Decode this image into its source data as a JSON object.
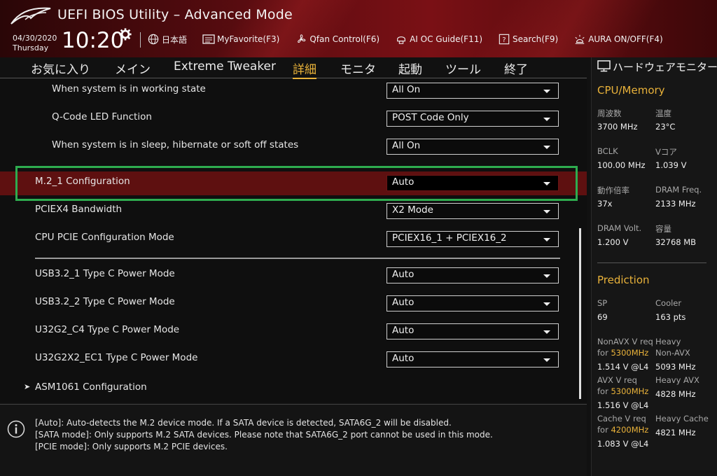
{
  "header": {
    "title": "UEFI BIOS Utility – Advanced Mode",
    "date": "04/30/2020",
    "day": "Thursday",
    "time": "10:20",
    "tools": [
      {
        "name": "language",
        "label": "日本語",
        "icon": "globe-icon"
      },
      {
        "name": "myfavorite",
        "label": "MyFavorite(F3)",
        "icon": "favorite-list-icon"
      },
      {
        "name": "qfan",
        "label": "Qfan Control(F6)",
        "icon": "fan-icon"
      },
      {
        "name": "aioc",
        "label": "AI OC Guide(F11)",
        "icon": "ai-chip-icon"
      },
      {
        "name": "search",
        "label": "Search(F9)",
        "icon": "question-box-icon"
      },
      {
        "name": "aura",
        "label": "AURA ON/OFF(F4)",
        "icon": "aura-light-icon"
      }
    ]
  },
  "nav": {
    "items": [
      "お気に入り",
      "メイン",
      "Extreme Tweaker",
      "詳細",
      "モニタ",
      "起動",
      "ツール",
      "終了"
    ],
    "active": "詳細"
  },
  "settings": [
    {
      "label": "When system is in working state",
      "value": "All On"
    },
    {
      "label": "Q-Code LED Function",
      "value": "POST Code Only"
    },
    {
      "label": "When system is in sleep, hibernate or soft off states",
      "value": "All On"
    },
    {
      "label": "M.2_1 Configuration",
      "value": "Auto"
    },
    {
      "label": "PCIEX4 Bandwidth",
      "value": "X2 Mode"
    },
    {
      "label": "CPU PCIE Configuration Mode",
      "value": "PCIEX16_1 + PCIEX16_2"
    },
    {
      "label": "USB3.2_1 Type C Power Mode",
      "value": "Auto"
    },
    {
      "label": "USB3.2_2 Type C Power Mode",
      "value": "Auto"
    },
    {
      "label": "U32G2_C4 Type C Power Mode",
      "value": "Auto"
    },
    {
      "label": "U32G2X2_EC1 Type C Power Mode",
      "value": "Auto"
    },
    {
      "label": "ASM1061 Configuration",
      "value": ""
    }
  ],
  "info": {
    "lines": [
      "[Auto]: Auto-detects the M.2 device mode. If a SATA device is detected, SATA6G_2 will be disabled.",
      "[SATA mode]: Only supports M.2 SATA devices. Please note that SATA6G_2 port cannot be used in this mode.",
      "[PCIE mode]: Only supports M.2 PCIE devices."
    ]
  },
  "monitor": {
    "title": "ハードウェアモニター",
    "cpu_section": "CPU/Memory",
    "cpu": {
      "freq_label": "周波数",
      "freq": "3700 MHz",
      "temp_label": "温度",
      "temp": "23°C",
      "bclk_label": "BCLK",
      "bclk": "100.00 MHz",
      "vcore_label": "Vコア",
      "vcore": "1.039 V",
      "ratio_label": "動作倍率",
      "ratio": "37x",
      "dram_freq_label": "DRAM Freq.",
      "dram_freq": "2133 MHz",
      "dram_volt_label": "DRAM Volt.",
      "dram_volt": "1.200 V",
      "capacity_label": "容量",
      "capacity": "32768 MB"
    },
    "prediction_section": "Prediction",
    "prediction": {
      "sp_label": "SP",
      "sp": "69",
      "cooler_label": "Cooler",
      "cooler": "163 pts",
      "nonavx_label": "NonAVX V req",
      "nonavx_for": "for ",
      "nonavx_freq": "5300MHz",
      "nonavx_v": "1.514 V @L4",
      "heavy_nonavx_label1": "Heavy",
      "heavy_nonavx_label2": "Non-AVX",
      "heavy_nonavx": "5093 MHz",
      "avx_label": "AVX V req",
      "avx_for": "for ",
      "avx_freq": "5300MHz",
      "avx_v": "1.516 V @L4",
      "heavy_avx_label": "Heavy AVX",
      "heavy_avx": "4828 MHz",
      "cache_label": "Cache V req",
      "cache_for": "for ",
      "cache_freq": "4200MHz",
      "cache_v": "1.083 V @L4",
      "heavy_cache_label": "Heavy Cache",
      "heavy_cache": "4821 MHz"
    }
  }
}
